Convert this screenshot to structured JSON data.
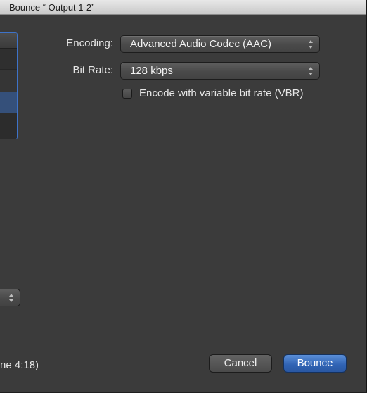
{
  "window": {
    "title": "Bounce “ Output 1-2”"
  },
  "encoding": {
    "label": "Encoding:",
    "value": "Advanced Audio Codec (AAC)",
    "icon": "updown-arrows-icon"
  },
  "bit_rate": {
    "label": "Bit Rate:",
    "value": "128 kbps",
    "icon": "updown-arrows-icon"
  },
  "vbr": {
    "label": "Encode with variable bit rate (VBR)",
    "checked": false
  },
  "footer": {
    "time_text": "ne 4:18)",
    "cancel_label": "Cancel",
    "bounce_label": "Bounce"
  },
  "colors": {
    "accent": "#2f62b3",
    "selection": "#35507a",
    "background": "#3b3b3b"
  }
}
